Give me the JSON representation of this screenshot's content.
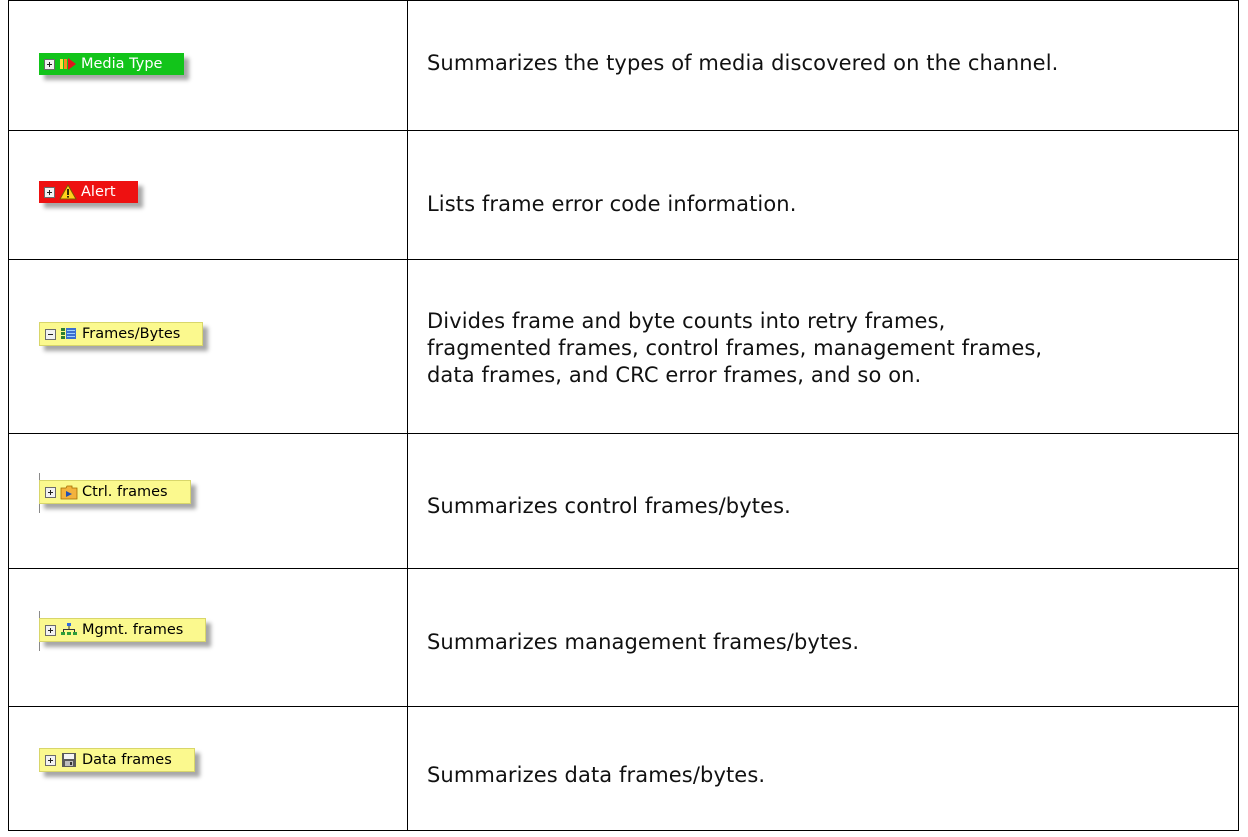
{
  "rows": [
    {
      "tag_label": "Media Type",
      "expander": "+",
      "icon": "media-arrow-icon",
      "tag_color": "#12c41a",
      "description_lines": [
        "Summarizes the types of media discovered on the channel."
      ]
    },
    {
      "tag_label": "Alert",
      "expander": "+",
      "icon": "warning-triangle-icon",
      "tag_color": "#ee1111",
      "description_lines": [
        "Lists frame error code information."
      ]
    },
    {
      "tag_label": "Frames/Bytes",
      "expander": "-",
      "icon": "frames-grid-icon",
      "tag_color": "#fbf98e",
      "description_lines": [
        "Divides frame and byte counts into retry frames,",
        "fragmented frames, control frames, management frames,",
        "data frames, and CRC error frames, and so on."
      ]
    },
    {
      "tag_label": "Ctrl. frames",
      "expander": "+",
      "icon": "control-folder-icon",
      "tag_color": "#fbf98e",
      "description_lines": [
        "Summarizes control frames/bytes."
      ]
    },
    {
      "tag_label": "Mgmt. frames",
      "expander": "+",
      "icon": "network-tree-icon",
      "tag_color": "#fbf98e",
      "description_lines": [
        "Summarizes management frames/bytes."
      ]
    },
    {
      "tag_label": "Data frames",
      "expander": "+",
      "icon": "floppy-disk-icon",
      "tag_color": "#fbf98e",
      "description_lines": [
        "Summarizes data frames/bytes."
      ]
    }
  ]
}
